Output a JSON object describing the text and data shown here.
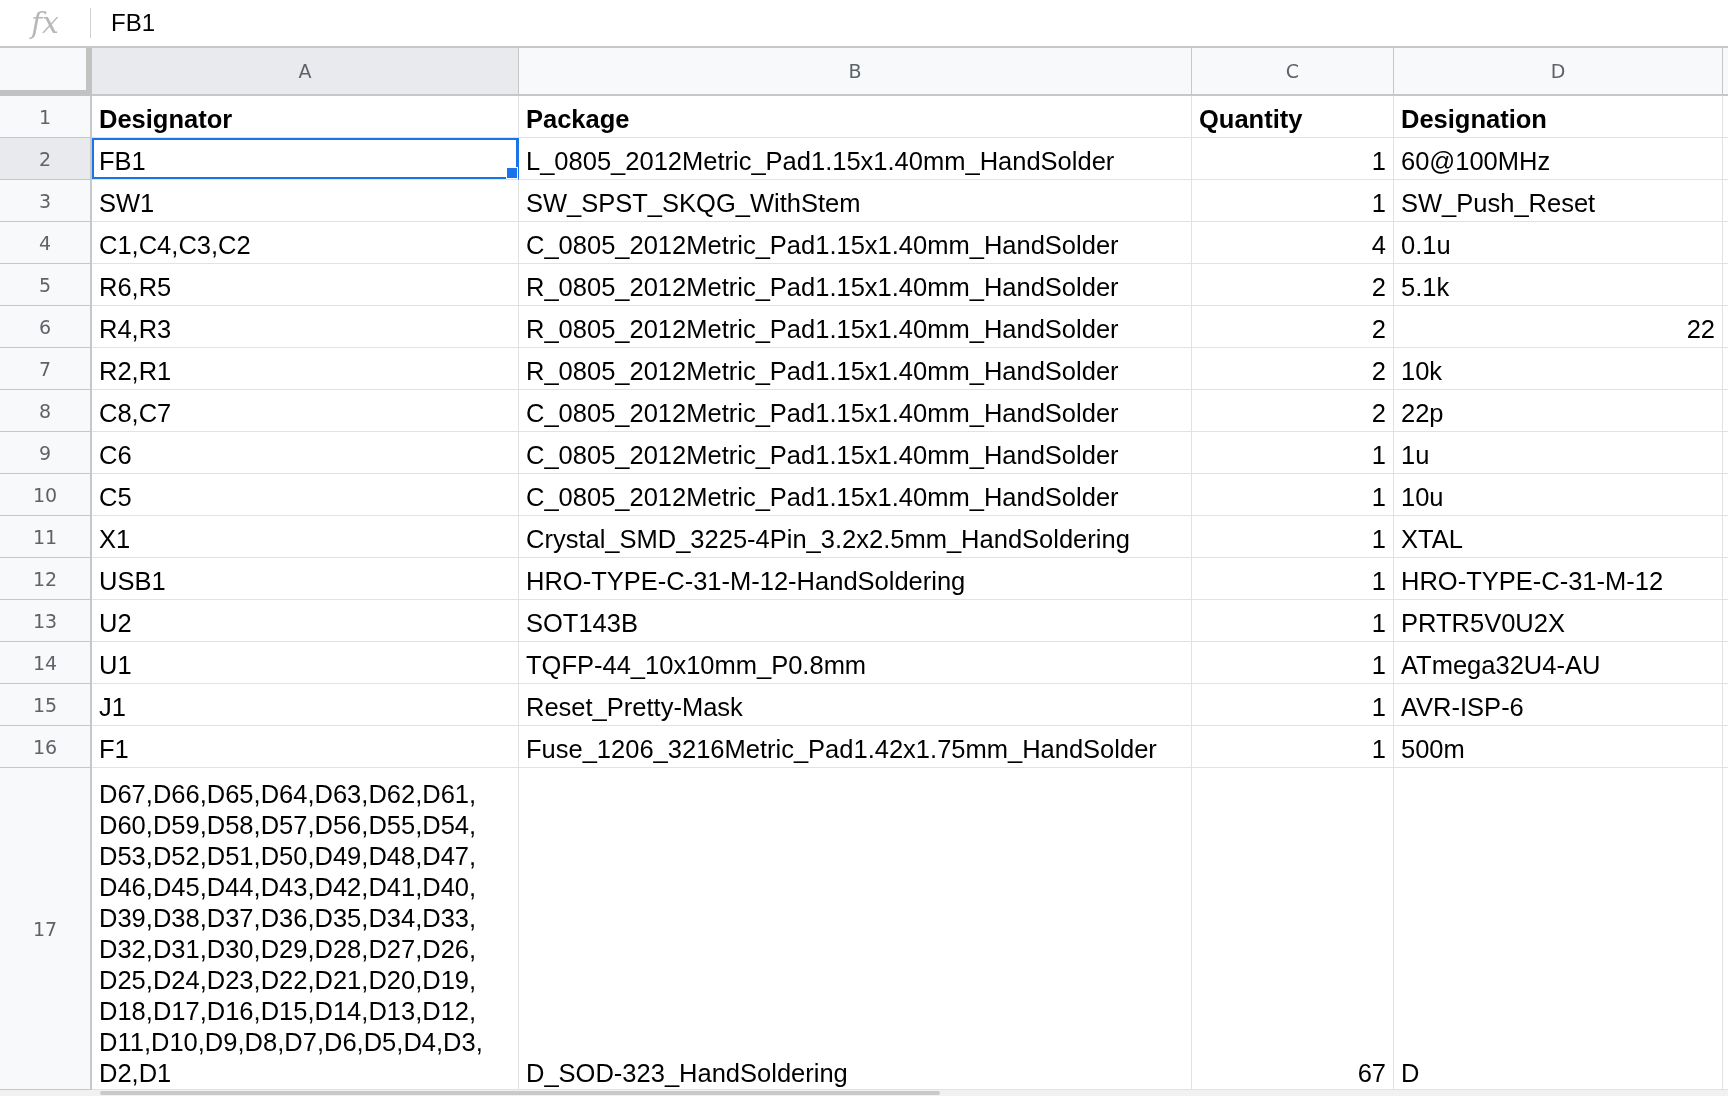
{
  "formula_bar": {
    "icon_text": "fx",
    "value": "FB1"
  },
  "columns": [
    {
      "label": "A",
      "selected": true
    },
    {
      "label": "B",
      "selected": false
    },
    {
      "label": "C",
      "selected": false
    },
    {
      "label": "D",
      "selected": false
    }
  ],
  "rows": [
    {
      "number": "1",
      "selected": false,
      "cells": [
        {
          "text": "Designator",
          "kind": "heading"
        },
        {
          "text": "Package",
          "kind": "heading"
        },
        {
          "text": "Quantity",
          "kind": "heading"
        },
        {
          "text": "Designation",
          "kind": "heading"
        }
      ]
    },
    {
      "number": "2",
      "selected": true,
      "cells": [
        {
          "text": "FB1",
          "kind": "text"
        },
        {
          "text": "L_0805_2012Metric_Pad1.15x1.40mm_HandSolder",
          "kind": "text"
        },
        {
          "text": "1",
          "kind": "number"
        },
        {
          "text": "60@100MHz",
          "kind": "text"
        }
      ]
    },
    {
      "number": "3",
      "selected": false,
      "cells": [
        {
          "text": "SW1",
          "kind": "text"
        },
        {
          "text": "SW_SPST_SKQG_WithStem",
          "kind": "text"
        },
        {
          "text": "1",
          "kind": "number"
        },
        {
          "text": "SW_Push_Reset",
          "kind": "text"
        }
      ]
    },
    {
      "number": "4",
      "selected": false,
      "cells": [
        {
          "text": "C1,C4,C3,C2",
          "kind": "text"
        },
        {
          "text": "C_0805_2012Metric_Pad1.15x1.40mm_HandSolder",
          "kind": "text"
        },
        {
          "text": "4",
          "kind": "number"
        },
        {
          "text": "0.1u",
          "kind": "text"
        }
      ]
    },
    {
      "number": "5",
      "selected": false,
      "cells": [
        {
          "text": "R6,R5",
          "kind": "text"
        },
        {
          "text": "R_0805_2012Metric_Pad1.15x1.40mm_HandSolder",
          "kind": "text"
        },
        {
          "text": "2",
          "kind": "number"
        },
        {
          "text": "5.1k",
          "kind": "text"
        }
      ]
    },
    {
      "number": "6",
      "selected": false,
      "cells": [
        {
          "text": "R4,R3",
          "kind": "text"
        },
        {
          "text": "R_0805_2012Metric_Pad1.15x1.40mm_HandSolder",
          "kind": "text"
        },
        {
          "text": "2",
          "kind": "number"
        },
        {
          "text": "22",
          "kind": "number"
        }
      ]
    },
    {
      "number": "7",
      "selected": false,
      "cells": [
        {
          "text": "R2,R1",
          "kind": "text"
        },
        {
          "text": "R_0805_2012Metric_Pad1.15x1.40mm_HandSolder",
          "kind": "text"
        },
        {
          "text": "2",
          "kind": "number"
        },
        {
          "text": "10k",
          "kind": "text"
        }
      ]
    },
    {
      "number": "8",
      "selected": false,
      "cells": [
        {
          "text": "C8,C7",
          "kind": "text"
        },
        {
          "text": "C_0805_2012Metric_Pad1.15x1.40mm_HandSolder",
          "kind": "text"
        },
        {
          "text": "2",
          "kind": "number"
        },
        {
          "text": "22p",
          "kind": "text"
        }
      ]
    },
    {
      "number": "9",
      "selected": false,
      "cells": [
        {
          "text": "C6",
          "kind": "text"
        },
        {
          "text": "C_0805_2012Metric_Pad1.15x1.40mm_HandSolder",
          "kind": "text"
        },
        {
          "text": "1",
          "kind": "number"
        },
        {
          "text": "1u",
          "kind": "text"
        }
      ]
    },
    {
      "number": "10",
      "selected": false,
      "cells": [
        {
          "text": "C5",
          "kind": "text"
        },
        {
          "text": "C_0805_2012Metric_Pad1.15x1.40mm_HandSolder",
          "kind": "text"
        },
        {
          "text": "1",
          "kind": "number"
        },
        {
          "text": "10u",
          "kind": "text"
        }
      ]
    },
    {
      "number": "11",
      "selected": false,
      "cells": [
        {
          "text": "X1",
          "kind": "text"
        },
        {
          "text": "Crystal_SMD_3225-4Pin_3.2x2.5mm_HandSoldering",
          "kind": "text"
        },
        {
          "text": "1",
          "kind": "number"
        },
        {
          "text": "XTAL",
          "kind": "text"
        }
      ]
    },
    {
      "number": "12",
      "selected": false,
      "cells": [
        {
          "text": "USB1",
          "kind": "text"
        },
        {
          "text": "HRO-TYPE-C-31-M-12-HandSoldering",
          "kind": "text"
        },
        {
          "text": "1",
          "kind": "number"
        },
        {
          "text": "HRO-TYPE-C-31-M-12",
          "kind": "text"
        }
      ]
    },
    {
      "number": "13",
      "selected": false,
      "cells": [
        {
          "text": "U2",
          "kind": "text"
        },
        {
          "text": "SOT143B",
          "kind": "text"
        },
        {
          "text": "1",
          "kind": "number"
        },
        {
          "text": "PRTR5V0U2X",
          "kind": "text"
        }
      ]
    },
    {
      "number": "14",
      "selected": false,
      "cells": [
        {
          "text": "U1",
          "kind": "text"
        },
        {
          "text": "TQFP-44_10x10mm_P0.8mm",
          "kind": "text"
        },
        {
          "text": "1",
          "kind": "number"
        },
        {
          "text": "ATmega32U4-AU",
          "kind": "text"
        }
      ]
    },
    {
      "number": "15",
      "selected": false,
      "cells": [
        {
          "text": "J1",
          "kind": "text"
        },
        {
          "text": "Reset_Pretty-Mask",
          "kind": "text"
        },
        {
          "text": "1",
          "kind": "number"
        },
        {
          "text": "AVR-ISP-6",
          "kind": "text"
        }
      ]
    },
    {
      "number": "16",
      "selected": false,
      "cells": [
        {
          "text": "F1",
          "kind": "text"
        },
        {
          "text": "Fuse_1206_3216Metric_Pad1.42x1.75mm_HandSolder",
          "kind": "text"
        },
        {
          "text": "1",
          "kind": "number"
        },
        {
          "text": "500m",
          "kind": "text"
        }
      ]
    },
    {
      "number": "17",
      "selected": false,
      "cells": [
        {
          "text": "D67,D66,D65,D64,D63,D62,D61,D60,D59,D58,D57,D56,D55,D54,D53,D52,D51,D50,D49,D48,D47,D46,D45,D44,D43,D42,D41,D40,D39,D38,D37,D36,D35,D34,D33,D32,D31,D30,D29,D28,D27,D26,D25,D24,D23,D22,D21,D20,D19,D18,D17,D16,D15,D14,D13,D12,D11,D10,D9,D8,D7,D6,D5,D4,D3,D2,D1",
          "kind": "text"
        },
        {
          "text": "D_SOD-323_HandSoldering",
          "kind": "text"
        },
        {
          "text": "67",
          "kind": "number"
        },
        {
          "text": "D",
          "kind": "text"
        }
      ]
    }
  ]
}
